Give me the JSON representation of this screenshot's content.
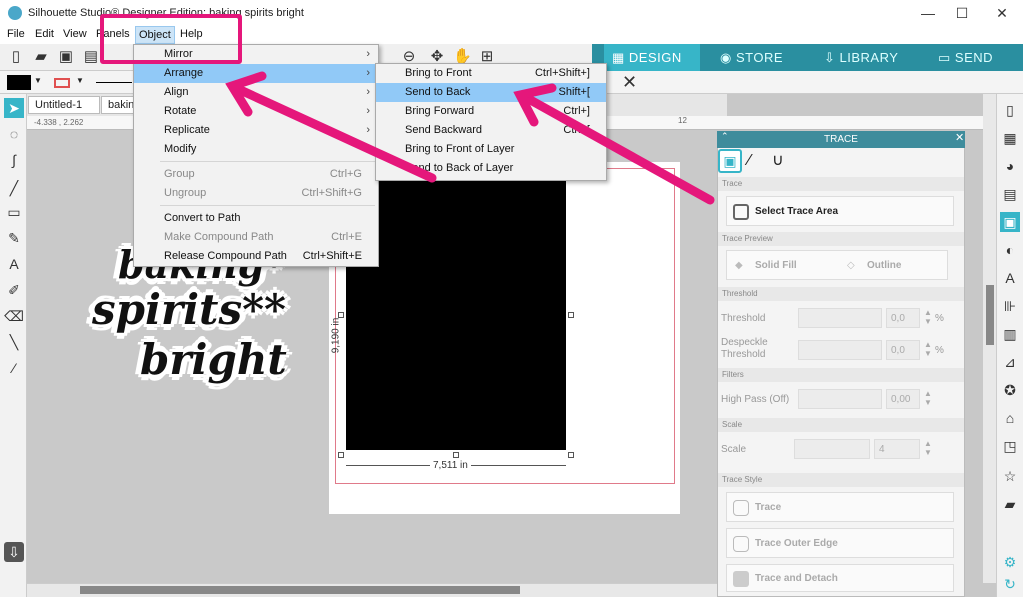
{
  "window": {
    "title": "Silhouette Studio® Designer Edition: baking spirits bright",
    "minimize": "—",
    "maximize": "☐",
    "close": "✕"
  },
  "menubar": [
    "File",
    "Edit",
    "View",
    "Panels",
    "Object",
    "Help"
  ],
  "tabs": [
    {
      "label": "DESIGN",
      "icon": "grid-icon",
      "active": true
    },
    {
      "label": "STORE",
      "icon": "s-logo-icon",
      "active": false
    },
    {
      "label": "LIBRARY",
      "icon": "download-icon",
      "active": false
    },
    {
      "label": "SEND",
      "icon": "send-icon",
      "active": false
    }
  ],
  "doc_tabs": [
    "Untitled-1",
    "baking"
  ],
  "ruler": {
    "coords": "-4.338 , 2.262",
    "tick": "12"
  },
  "object_menu": [
    {
      "label": "Mirror",
      "shortcut": "",
      "submenu": true,
      "enabled": true
    },
    {
      "label": "Arrange",
      "shortcut": "",
      "submenu": true,
      "enabled": true,
      "highlighted": true
    },
    {
      "label": "Align",
      "shortcut": "",
      "submenu": true,
      "enabled": true
    },
    {
      "label": "Rotate",
      "shortcut": "",
      "submenu": true,
      "enabled": true
    },
    {
      "label": "Replicate",
      "shortcut": "",
      "submenu": true,
      "enabled": true
    },
    {
      "label": "Modify",
      "shortcut": "",
      "submenu": true,
      "enabled": true
    },
    {
      "label": "Group",
      "shortcut": "Ctrl+G",
      "submenu": false,
      "enabled": false
    },
    {
      "label": "Ungroup",
      "shortcut": "Ctrl+Shift+G",
      "submenu": false,
      "enabled": false
    },
    {
      "label": "Convert to Path",
      "shortcut": "",
      "submenu": false,
      "enabled": true
    },
    {
      "label": "Make Compound Path",
      "shortcut": "Ctrl+E",
      "submenu": false,
      "enabled": false
    },
    {
      "label": "Release Compound Path",
      "shortcut": "Ctrl+Shift+E",
      "submenu": false,
      "enabled": true
    }
  ],
  "arrange_submenu": [
    {
      "label": "Bring to Front",
      "shortcut": "Ctrl+Shift+]"
    },
    {
      "label": "Send to Back",
      "shortcut": "Shift+[",
      "highlighted": true
    },
    {
      "label": "Bring Forward",
      "shortcut": "Ctrl+]"
    },
    {
      "label": "Send Backward",
      "shortcut": "Ctrl+["
    },
    {
      "label": "Bring to Front of Layer",
      "shortcut": ""
    },
    {
      "label": "Send to Back of Layer",
      "shortcut": ""
    }
  ],
  "canvas": {
    "width_dim": "7,511 in",
    "height_dim": "9,190 in",
    "sticker_lines": [
      "baking*",
      "spirits**",
      "bright"
    ]
  },
  "trace_panel": {
    "title": "TRACE",
    "sections": {
      "trace": "Trace",
      "preview": "Trace Preview",
      "threshold": "Threshold",
      "filters": "Filters",
      "scale": "Scale",
      "style": "Trace Style"
    },
    "select_area": "Select Trace Area",
    "solid_fill": "Solid Fill",
    "outline": "Outline",
    "threshold_label": "Threshold",
    "threshold_value": "0,0",
    "threshold_unit": "%",
    "despeckle_label": "Despeckle Threshold",
    "despeckle_value": "0,0",
    "despeckle_unit": "%",
    "highpass_label": "High Pass (Off)",
    "highpass_value": "0,00",
    "scale_label": "Scale",
    "scale_value": "4",
    "trace_btn": "Trace",
    "trace_outer_btn": "Trace Outer Edge",
    "trace_detach_btn": "Trace and Detach"
  },
  "colors": {
    "accent": "#37b5c8",
    "tabbar": "#2a8fa0",
    "annotation": "#e5177b",
    "menu_highlight": "#91c9f7"
  }
}
